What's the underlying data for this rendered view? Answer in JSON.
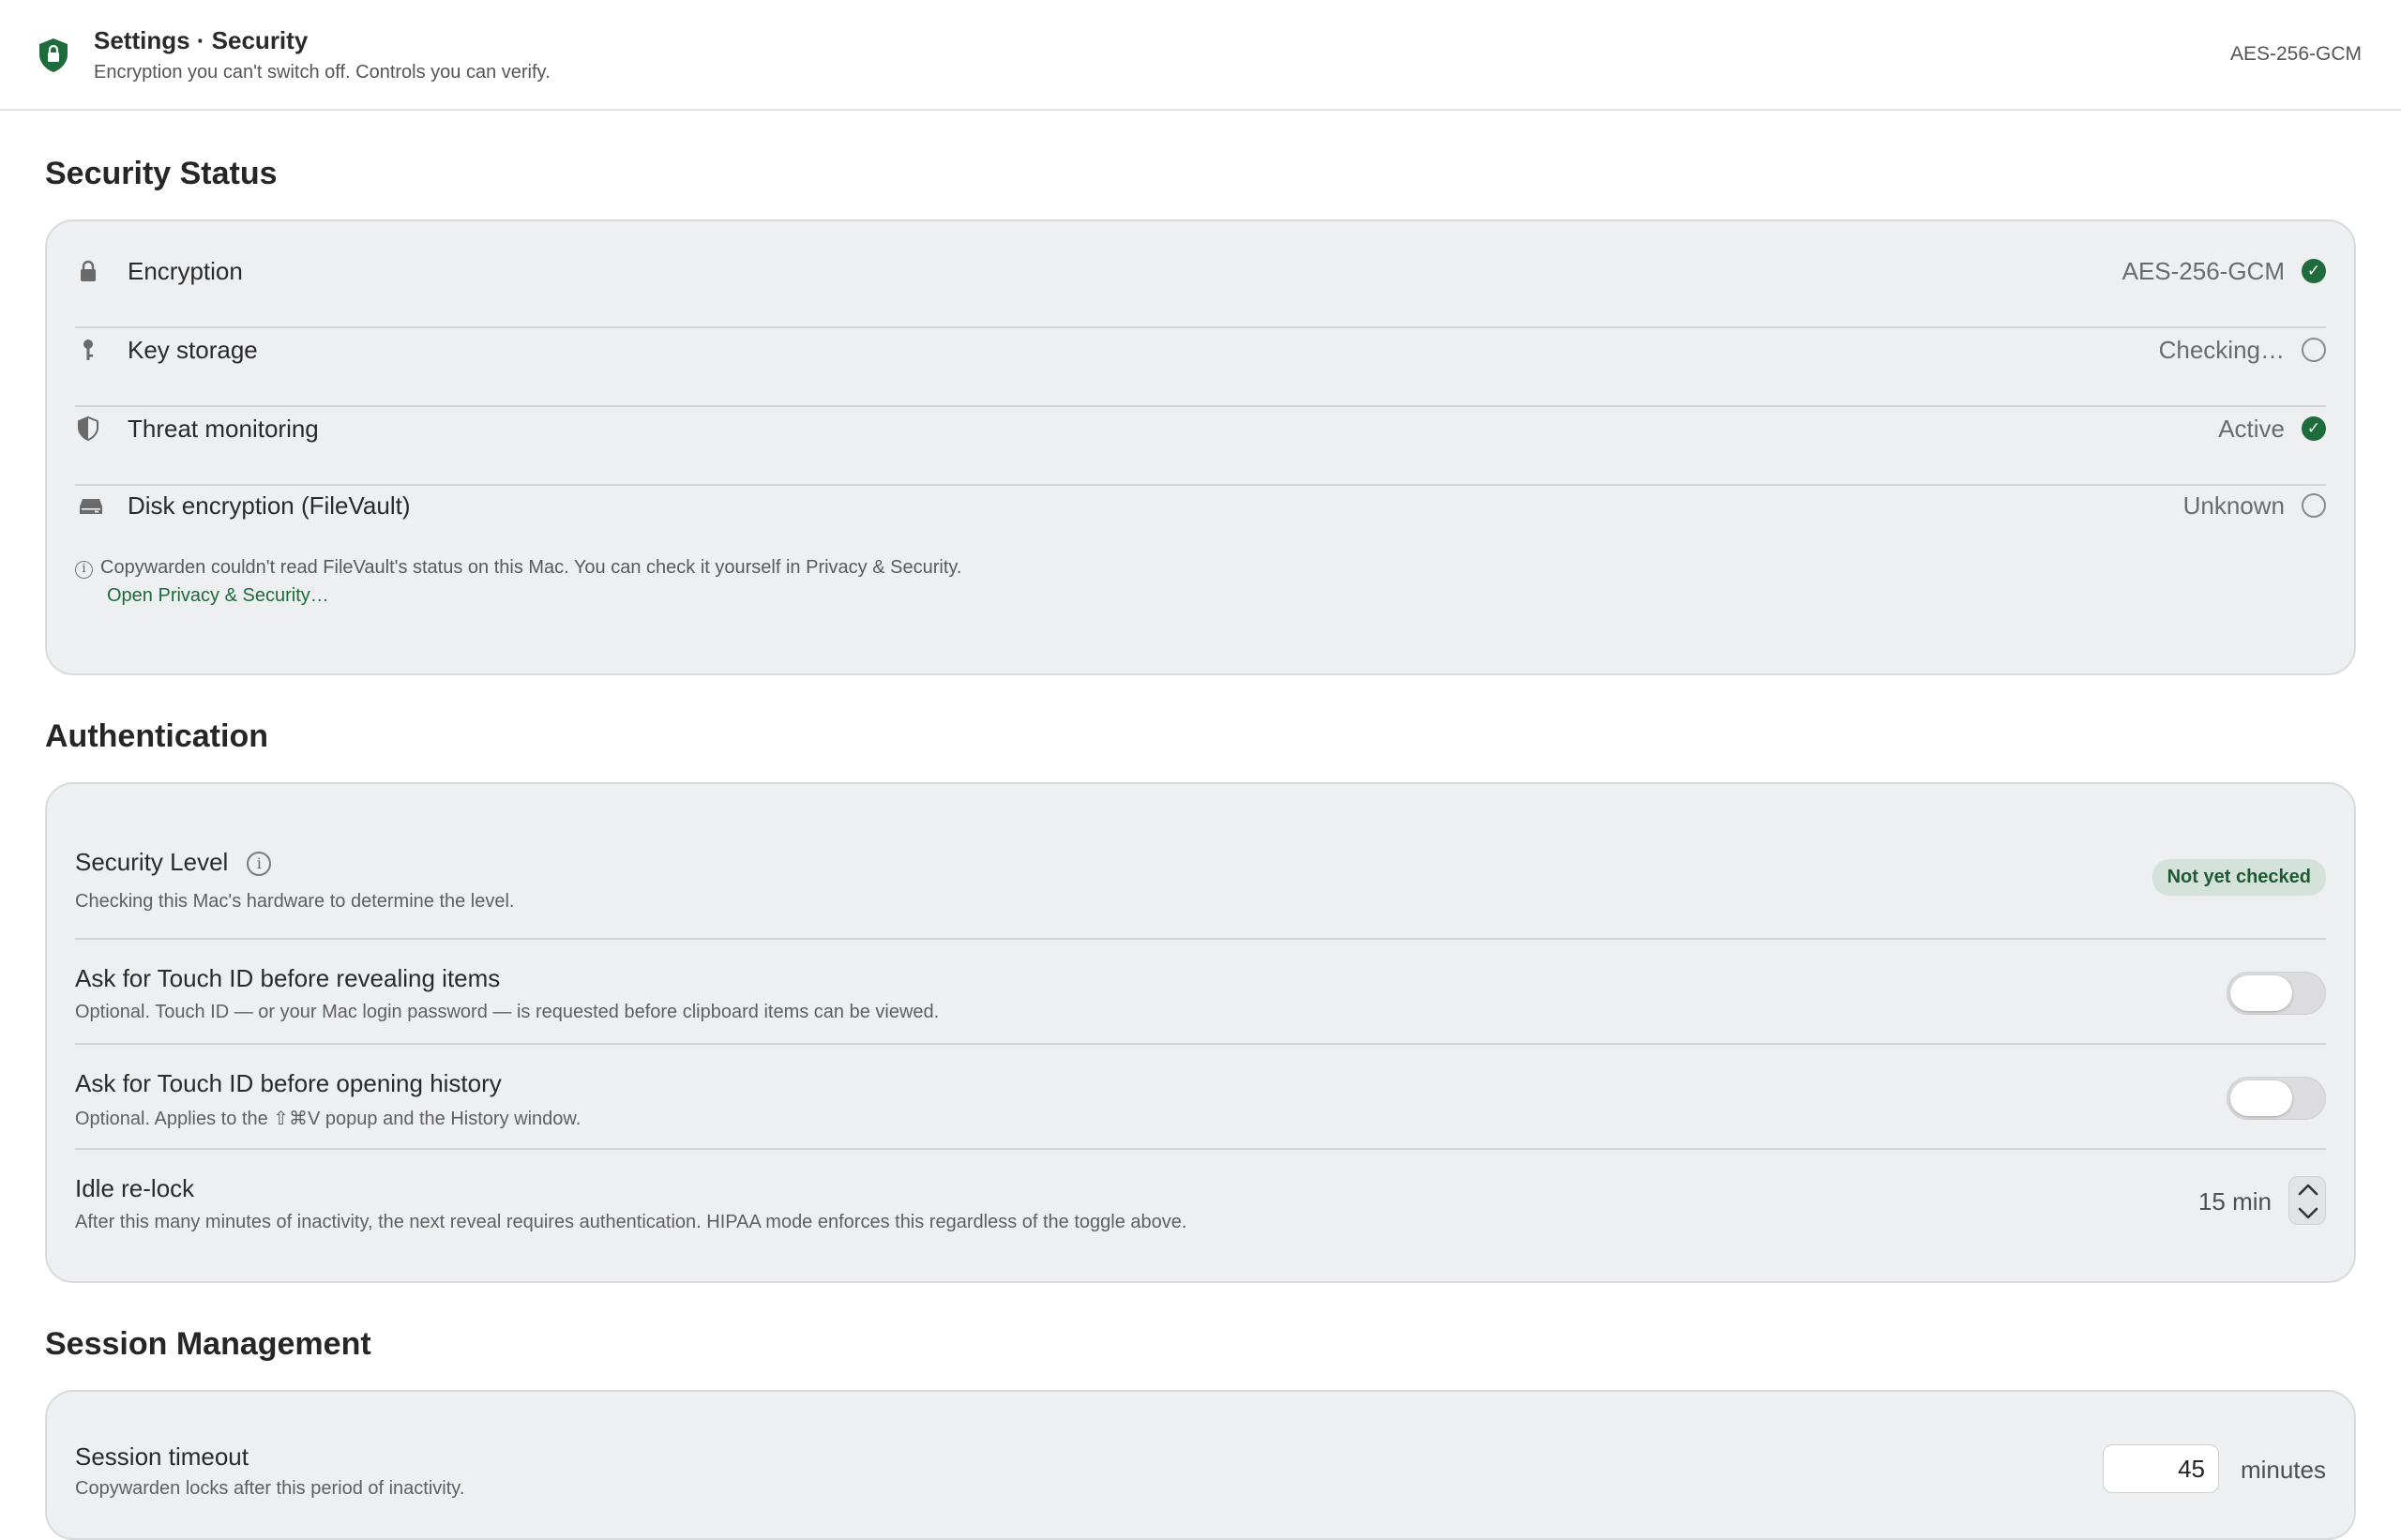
{
  "header": {
    "title": "Settings · Security",
    "subtitle": "Encryption you can't switch off. Controls you can verify.",
    "badge": "AES-256-GCM",
    "icon": "shield-lock-icon",
    "accent": "#1e6b3c"
  },
  "security_status": {
    "title": "Security Status",
    "rows": [
      {
        "icon": "lock-icon",
        "label": "Encryption",
        "value": "AES-256-GCM",
        "status": "ok"
      },
      {
        "icon": "key-icon",
        "label": "Key storage",
        "value": "Checking…",
        "status": "pending"
      },
      {
        "icon": "shield-icon",
        "label": "Threat monitoring",
        "value": "Active",
        "status": "ok"
      },
      {
        "icon": "disk-icon",
        "label": "Disk encryption (FileVault)",
        "value": "Unknown",
        "status": "pending"
      }
    ],
    "note": "Copywarden couldn't read FileVault's status on this Mac. You can check it yourself in Privacy & Security.",
    "note_link": "Open Privacy & Security…"
  },
  "authentication": {
    "title": "Authentication",
    "security_level": {
      "label": "Security Level",
      "description": "Checking this Mac's hardware to determine the level.",
      "badge": "Not yet checked"
    },
    "touch_id_reveal": {
      "label": "Ask for Touch ID before revealing items",
      "description": "Optional. Touch ID — or your Mac login password — is requested before clipboard items can be viewed.",
      "enabled": false
    },
    "touch_id_history": {
      "label": "Ask for Touch ID before opening history",
      "description": "Optional. Applies to the ⇧⌘V popup and the History window.",
      "enabled": false
    },
    "idle_relock": {
      "label": "Idle re-lock",
      "description": "After this many minutes of inactivity, the next reveal requires authentication. HIPAA mode enforces this regardless of the toggle above.",
      "value": "15 min"
    }
  },
  "session": {
    "title": "Session Management",
    "timeout": {
      "label": "Session timeout",
      "description": "Copywarden locks after this period of inactivity.",
      "value": "45",
      "unit": "minutes"
    }
  }
}
